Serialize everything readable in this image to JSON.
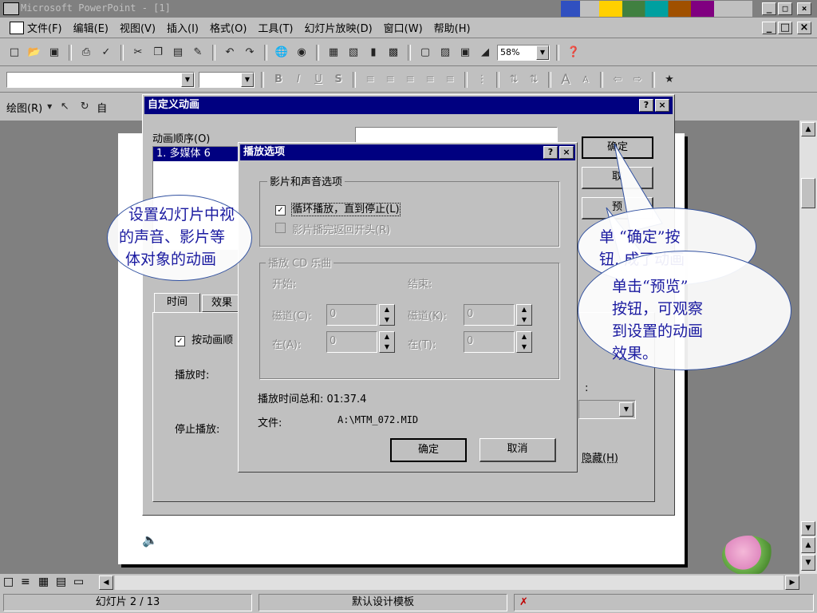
{
  "app": {
    "title": "Microsoft PowerPoint - [1]",
    "min": "_",
    "max": "□",
    "close": "×",
    "doc_controls": [
      "_",
      "□",
      "×"
    ]
  },
  "menu": [
    "文件(F)",
    "编辑(E)",
    "视图(V)",
    "插入(I)",
    "格式(O)",
    "工具(T)",
    "幻灯片放映(D)",
    "窗口(W)",
    "帮助(H)"
  ],
  "standard_toolbar": {
    "zoom": "58%"
  },
  "format_toolbar": {
    "font": "",
    "size": ""
  },
  "drawing_toolbar": {
    "draw_label": "绘图(R)",
    "autoshape_partial": "自"
  },
  "custom_anim": {
    "title": "自定义动画",
    "order_label": "动画顺序(O)",
    "order_item": "1. 多媒体 6",
    "ok": "确定",
    "cancel_partial": "取",
    "preview_partial": "预",
    "tabs": [
      "时间",
      "效果"
    ],
    "animate_label": "按动画顺",
    "play_label": "播放时:",
    "stop_label": "停止播放:",
    "hide_label": "隐藏(H)",
    "colon": ":"
  },
  "play_options": {
    "title": "播放选项",
    "group_movie": "影片和声音选项",
    "loop_label": "循环播放，直到停止(L)",
    "loop_checked": true,
    "rewind_label": "影片播完返回开头(R)",
    "rewind_checked": false,
    "group_cd": "播放 CD 乐曲",
    "start_label": "开始:",
    "end_label": "结束:",
    "track_start_label": "磁道(C):",
    "track_start_value": "0",
    "track_end_label": "磁道(K):",
    "track_end_value": "0",
    "at_start_label": "在(A):",
    "at_start_value": "0",
    "at_end_label": "在(T):",
    "at_end_value": "0",
    "total_time": "播放时间总和: 01:37.4",
    "file_label": "文件:",
    "file_path": "A:\\MTM_072.MID",
    "ok": "确定",
    "cancel": "取消",
    "help": "?",
    "close": "×"
  },
  "callouts": {
    "left": [
      "设置幻灯片中视",
      "的声音、影片等",
      "体对象的动画"
    ],
    "right_top": [
      "单 “确定”按",
      "钮, 成了动画"
    ],
    "right_bottom": [
      "单击“预览”",
      "按钮，可观察",
      "到设置的动画",
      "效果。"
    ]
  },
  "status": {
    "slide": "幻灯片 2 / 13",
    "template": "默认设计模板"
  },
  "colors": {
    "titlebar": "#000080",
    "callout_text": "#1a1aa0",
    "desktop_grey": "#c0c0c0",
    "slide_area": "#808080"
  }
}
